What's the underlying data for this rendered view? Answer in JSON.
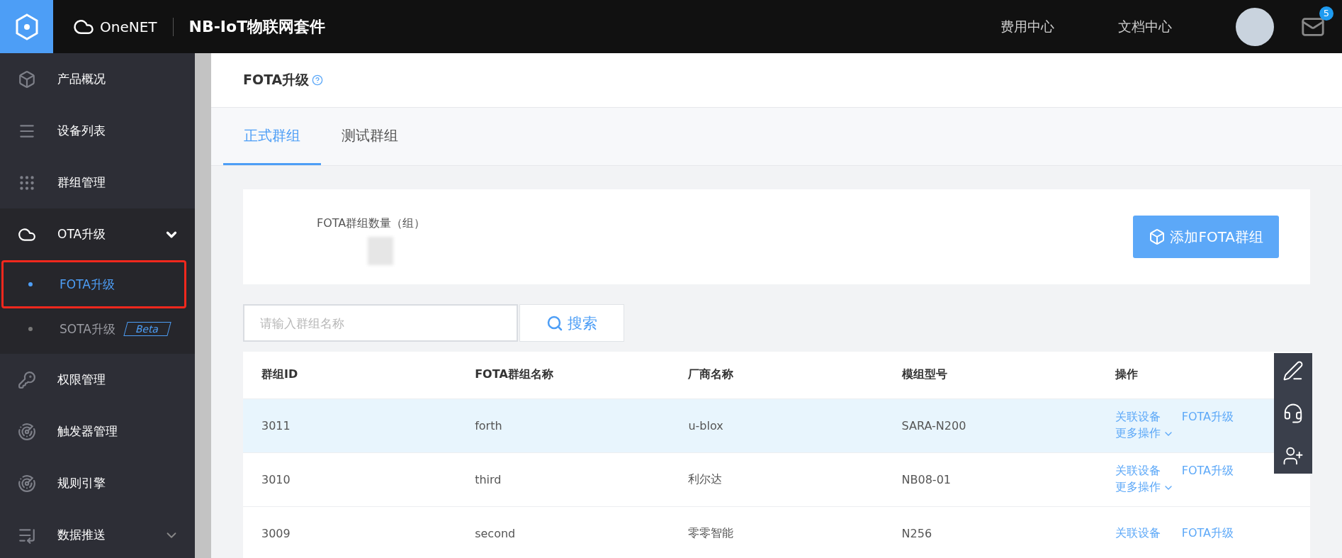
{
  "app": {
    "product": "OneNET",
    "suite": "NB-IoT物联网套件"
  },
  "top_nav": [
    {
      "label": "费用中心"
    },
    {
      "label": "文档中心"
    }
  ],
  "notifications": {
    "count": "5"
  },
  "sidebar": {
    "items": [
      {
        "label": "产品概况"
      },
      {
        "label": "设备列表"
      },
      {
        "label": "群组管理"
      },
      {
        "label": "OTA升级",
        "expanded": true,
        "children": [
          {
            "label": "FOTA升级",
            "selected": true,
            "highlighted": true
          },
          {
            "label": "SOTA升级",
            "selected": false,
            "highlighted": false,
            "badge": "Beta"
          }
        ]
      },
      {
        "label": "权限管理"
      },
      {
        "label": "触发器管理"
      },
      {
        "label": "规则引擎"
      },
      {
        "label": "数据推送",
        "expanded": false
      }
    ]
  },
  "page_title": "FOTA升级",
  "tabs": [
    {
      "label": "正式群组",
      "selected": true
    },
    {
      "label": "测试群组",
      "selected": false
    }
  ],
  "summary": {
    "label": "FOTA群组数量（组）",
    "add_button": "添加FOTA群组"
  },
  "search": {
    "placeholder": "请输入群组名称",
    "button": "搜索"
  },
  "table": {
    "columns": [
      "群组ID",
      "FOTA群组名称",
      "厂商名称",
      "模组型号",
      "操作"
    ],
    "rows": [
      {
        "cells": [
          "3011",
          "forth",
          "u-blox",
          "SARA-N200"
        ],
        "selected": true,
        "actions": [
          "关联设备",
          "FOTA升级",
          "更多操作"
        ]
      },
      {
        "cells": [
          "3010",
          "third",
          "利尔达",
          "NB08-01"
        ],
        "selected": false,
        "actions": [
          "关联设备",
          "FOTA升级",
          "更多操作"
        ]
      },
      {
        "cells": [
          "3009",
          "second",
          "零零智能",
          "N256"
        ],
        "selected": false,
        "actions": [
          "关联设备",
          "FOTA升级"
        ]
      }
    ]
  }
}
